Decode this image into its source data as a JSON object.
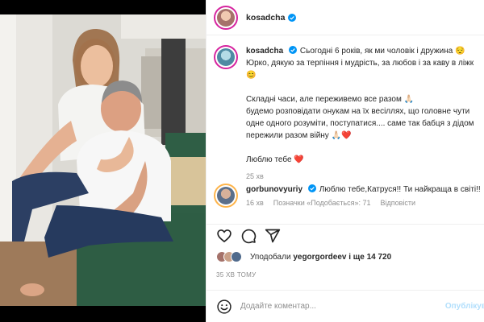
{
  "post": {
    "author": "kosadcha",
    "caption_lines": [
      "Сьогодні 6 років, як ми чоловік і дружина 😌",
      "Юрко, дякую за терпіння і мудрість, за любов і за каву в ліжк",
      "😊"
    ],
    "caption_lines_2": [
      "Складні часи, але переживемо все разом 🙏🏻",
      "будемо розповідати онукам на їх весіллях, що головне чути",
      "одне одного розуміти, поступатися.... саме так бабця з дідом",
      "пережили разом війну 🙏🏻❤️"
    ],
    "caption_line_3": "Люблю тебе ❤️",
    "caption_time": "25 хв"
  },
  "comment": {
    "author": "gorbunovyuriy",
    "text": "Люблю тебе,Катруся!! Ти найкраща в світі!!",
    "time": "16 хв",
    "likes_label": "Позначки «Подобається»: 71",
    "reply_label": "Відповісти"
  },
  "likes": {
    "prefix": "Уподобали",
    "user": "yegorgordeev",
    "suffix": "і ще 14 720"
  },
  "post_time": "35 ХВ ТОМУ",
  "composer": {
    "placeholder": "Додайте коментар...",
    "publish_label": "Опублікув"
  },
  "colors": {
    "accent": "#0095f6",
    "publish_disabled": "#b2dffc",
    "heart": "#ed4956",
    "muted": "#8e8e8e"
  },
  "icons": [
    "verified-badge-icon",
    "heart-icon",
    "comment-icon",
    "share-icon",
    "emoji-icon"
  ]
}
